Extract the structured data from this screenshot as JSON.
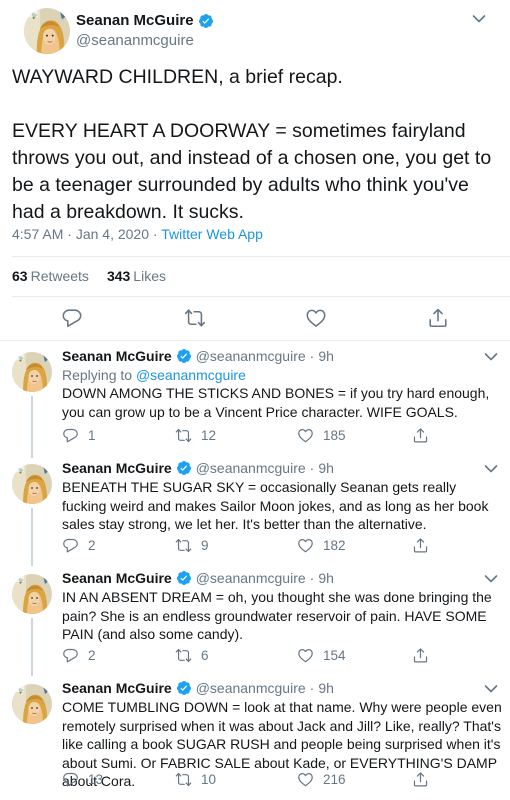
{
  "main_tweet": {
    "author_name": "Seanan McGuire",
    "author_handle": "@seananmcguire",
    "text": "WAYWARD CHILDREN, a brief recap.\n\nEVERY HEART A DOORWAY = sometimes fairyland throws you out, and instead of a chosen one, you get to be a teenager surrounded by adults who think you've had a breakdown. It sucks.",
    "time": "4:57 AM",
    "date": "Jan 4, 2020",
    "separator": "·",
    "client": "Twitter Web App",
    "retweets_count": "63",
    "retweets_label": "Retweets",
    "likes_count": "343",
    "likes_label": "Likes"
  },
  "replies": [
    {
      "author_name": "Seanan McGuire",
      "author_handle": "@seananmcguire",
      "time": "9h",
      "replying_prefix": "Replying to",
      "replying_to": "@seananmcguire",
      "text": "DOWN AMONG THE STICKS AND BONES = if you try hard enough, you can grow up to be a Vincent Price character. WIFE GOALS.",
      "reply_count": "1",
      "retweet_count": "12",
      "like_count": "185"
    },
    {
      "author_name": "Seanan McGuire",
      "author_handle": "@seananmcguire",
      "time": "9h",
      "text": "BENEATH THE SUGAR SKY = occasionally Seanan gets really fucking weird and makes Sailor Moon jokes, and as long as her book sales stay strong, we let her. It's better than the alternative.",
      "reply_count": "2",
      "retweet_count": "9",
      "like_count": "182"
    },
    {
      "author_name": "Seanan McGuire",
      "author_handle": "@seananmcguire",
      "time": "9h",
      "text": "IN AN ABSENT DREAM = oh, you thought she was done bringing the pain? She is an endless groundwater reservoir of pain. HAVE SOME PAIN (and also some candy).",
      "reply_count": "2",
      "retweet_count": "6",
      "like_count": "154"
    },
    {
      "author_name": "Seanan McGuire",
      "author_handle": "@seananmcguire",
      "time": "9h",
      "text": "COME TUMBLING DOWN = look at that name. Why were people even remotely surprised when it was about Jack and Jill? Like, really? That's like calling a book SUGAR RUSH and people being surprised when it's about Sumi. Or FABRIC SALE about Kade, or EVERYTHING'S DAMP about Cora.",
      "reply_count": "13",
      "retweet_count": "10",
      "like_count": "216"
    }
  ],
  "icons": {
    "verified": "verified-badge-icon",
    "caret": "chevron-down-icon",
    "reply": "reply-icon",
    "retweet": "retweet-icon",
    "like": "heart-icon",
    "share": "share-icon"
  },
  "colors": {
    "accent": "#1da1f2",
    "link": "#1b95e0",
    "muted": "#657786",
    "text": "#14171a",
    "divider": "#e6ecf0",
    "thread_line": "#ccd6dd"
  }
}
